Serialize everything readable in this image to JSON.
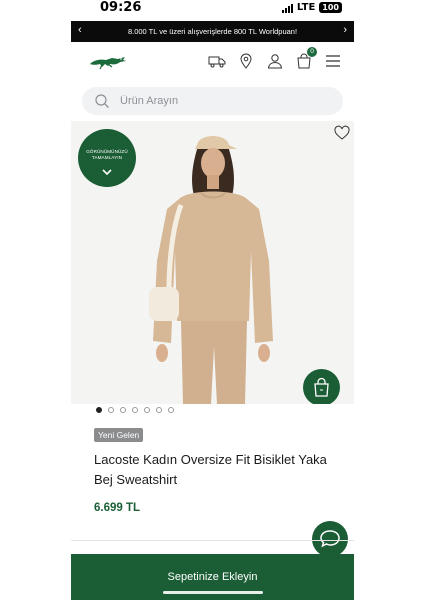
{
  "status_bar": {
    "time": "09:26",
    "network": "LTE",
    "battery": "100"
  },
  "promo": {
    "text": "8.000 TL ve üzeri alışverişlerde 800 TL Worldpuan!"
  },
  "header": {
    "logo": "lacoste-crocodile-logo",
    "icons": [
      "truck-icon",
      "location-icon",
      "user-icon",
      "cart-icon",
      "menu-icon"
    ],
    "cart_count": "0"
  },
  "search": {
    "placeholder": "Ürün Arayın"
  },
  "product": {
    "badge_text": "GÖRÜNÜMÜNÜZÜ TAMAMLAYIN",
    "image_count": 7,
    "active_image": 1,
    "tag": "Yeni Gelen",
    "title": "Lacoste Kadın Oversize Fit Bisiklet Yaka Bej Sweatshirt",
    "price": "6.699 TL"
  },
  "cta": {
    "label": "Sepetinize Ekleyin"
  },
  "colors": {
    "brand_green": "#1b5e36",
    "promo_bg": "#0b0b0b",
    "tag_bg": "#8a8c8e"
  }
}
